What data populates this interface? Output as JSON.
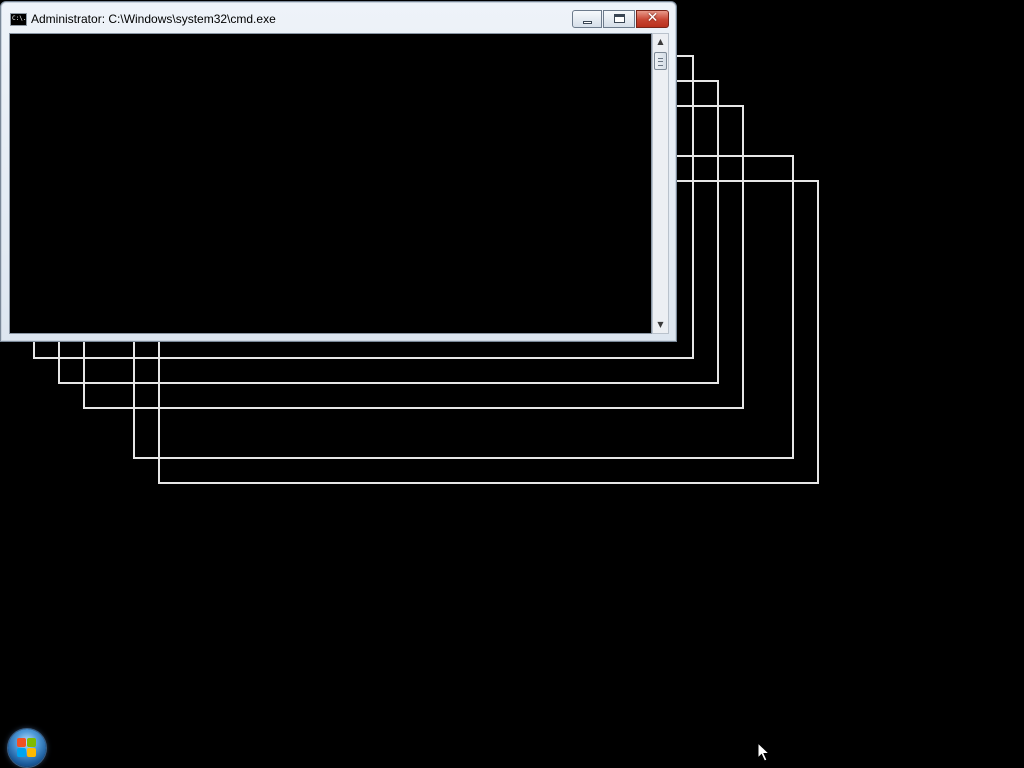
{
  "window": {
    "title": "Administrator: C:\\Windows\\system32\\cmd.exe",
    "icon_name": "cmd-icon",
    "icon_text": "C:\\."
  },
  "caption_buttons": {
    "minimize_icon": "minimize-icon",
    "maximize_icon": "restore-icon",
    "close_icon": "close-icon",
    "close_glyph": "✕"
  },
  "scrollbar": {
    "up_arrow": "▲",
    "down_arrow": "▼"
  },
  "taskbar": {
    "start_icon": "windows-start-orb-icon"
  },
  "colors": {
    "desktop_background": "#000000",
    "ghost_outline": "#e6e6e6",
    "console_background": "#000000",
    "close_button": "#c84532"
  }
}
